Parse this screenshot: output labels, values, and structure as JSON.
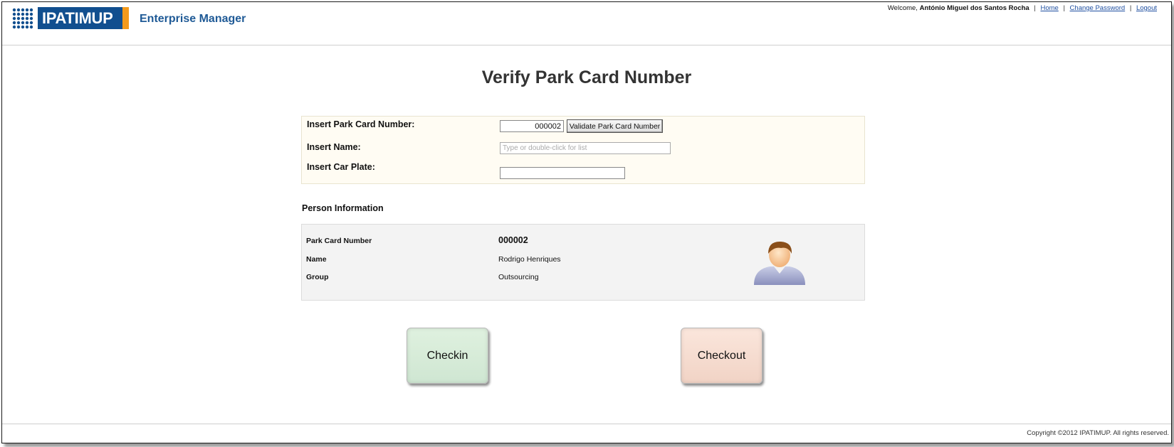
{
  "header": {
    "logo_text": "IPATIMUP",
    "app_title": "Enterprise Manager",
    "welcome_prefix": "Welcome,",
    "user_name": "António Miguel dos Santos Rocha",
    "links": {
      "home": "Home",
      "change_password": "Change Password",
      "logout": "Logout"
    },
    "separator": "|"
  },
  "page_title": "Verify Park Card Number",
  "form": {
    "card_label": "Insert Park Card Number:",
    "card_value": "000002",
    "validate_label": "Validate Park Card Number",
    "name_label": "Insert Name:",
    "name_placeholder": "Type or double-click for list",
    "plate_label": "Insert Car Plate:",
    "plate_value": ""
  },
  "person": {
    "heading": "Person Information",
    "fields": [
      {
        "label": "Park Card Number",
        "value": "000002"
      },
      {
        "label": "Name",
        "value": "Rodrigo Henriques"
      },
      {
        "label": "Group",
        "value": "Outsourcing"
      }
    ],
    "avatar_icon": "user-avatar-icon"
  },
  "actions": {
    "checkin_label": "Checkin",
    "checkout_label": "Checkout"
  },
  "footer": {
    "copyright": "Copyright ©2012 IPATIMUP. All rights reserved."
  },
  "colors": {
    "brand_blue": "#114f8f",
    "brand_orange": "#f39a1c",
    "title_blue": "#1f5a96",
    "link_blue": "#1f4fa0",
    "checkin_green": "#d6ecd8",
    "checkout_peach": "#f6dccf"
  }
}
